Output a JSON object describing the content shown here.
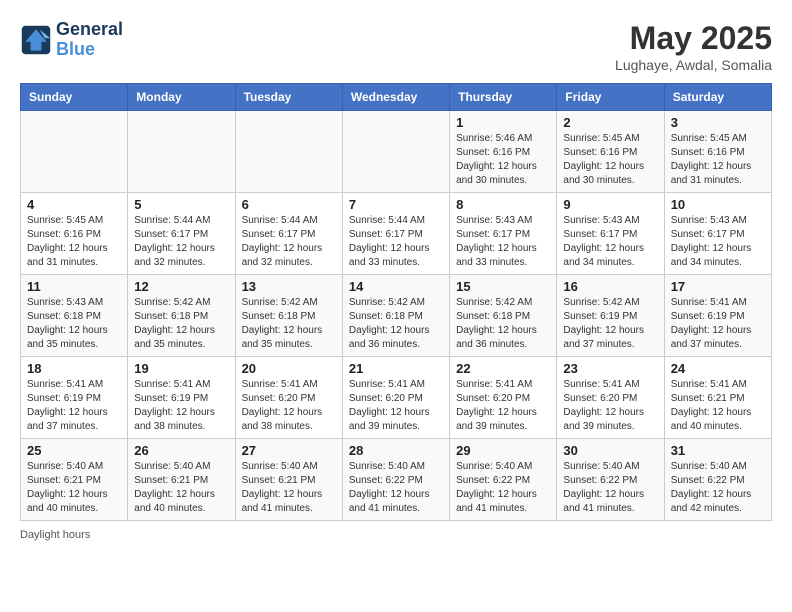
{
  "header": {
    "logo_line1": "General",
    "logo_line2": "Blue",
    "month_title": "May 2025",
    "location": "Lughaye, Awdal, Somalia"
  },
  "weekdays": [
    "Sunday",
    "Monday",
    "Tuesday",
    "Wednesday",
    "Thursday",
    "Friday",
    "Saturday"
  ],
  "weeks": [
    [
      {
        "day": "",
        "info": ""
      },
      {
        "day": "",
        "info": ""
      },
      {
        "day": "",
        "info": ""
      },
      {
        "day": "",
        "info": ""
      },
      {
        "day": "1",
        "info": "Sunrise: 5:46 AM\nSunset: 6:16 PM\nDaylight: 12 hours\nand 30 minutes."
      },
      {
        "day": "2",
        "info": "Sunrise: 5:45 AM\nSunset: 6:16 PM\nDaylight: 12 hours\nand 30 minutes."
      },
      {
        "day": "3",
        "info": "Sunrise: 5:45 AM\nSunset: 6:16 PM\nDaylight: 12 hours\nand 31 minutes."
      }
    ],
    [
      {
        "day": "4",
        "info": "Sunrise: 5:45 AM\nSunset: 6:16 PM\nDaylight: 12 hours\nand 31 minutes."
      },
      {
        "day": "5",
        "info": "Sunrise: 5:44 AM\nSunset: 6:17 PM\nDaylight: 12 hours\nand 32 minutes."
      },
      {
        "day": "6",
        "info": "Sunrise: 5:44 AM\nSunset: 6:17 PM\nDaylight: 12 hours\nand 32 minutes."
      },
      {
        "day": "7",
        "info": "Sunrise: 5:44 AM\nSunset: 6:17 PM\nDaylight: 12 hours\nand 33 minutes."
      },
      {
        "day": "8",
        "info": "Sunrise: 5:43 AM\nSunset: 6:17 PM\nDaylight: 12 hours\nand 33 minutes."
      },
      {
        "day": "9",
        "info": "Sunrise: 5:43 AM\nSunset: 6:17 PM\nDaylight: 12 hours\nand 34 minutes."
      },
      {
        "day": "10",
        "info": "Sunrise: 5:43 AM\nSunset: 6:17 PM\nDaylight: 12 hours\nand 34 minutes."
      }
    ],
    [
      {
        "day": "11",
        "info": "Sunrise: 5:43 AM\nSunset: 6:18 PM\nDaylight: 12 hours\nand 35 minutes."
      },
      {
        "day": "12",
        "info": "Sunrise: 5:42 AM\nSunset: 6:18 PM\nDaylight: 12 hours\nand 35 minutes."
      },
      {
        "day": "13",
        "info": "Sunrise: 5:42 AM\nSunset: 6:18 PM\nDaylight: 12 hours\nand 35 minutes."
      },
      {
        "day": "14",
        "info": "Sunrise: 5:42 AM\nSunset: 6:18 PM\nDaylight: 12 hours\nand 36 minutes."
      },
      {
        "day": "15",
        "info": "Sunrise: 5:42 AM\nSunset: 6:18 PM\nDaylight: 12 hours\nand 36 minutes."
      },
      {
        "day": "16",
        "info": "Sunrise: 5:42 AM\nSunset: 6:19 PM\nDaylight: 12 hours\nand 37 minutes."
      },
      {
        "day": "17",
        "info": "Sunrise: 5:41 AM\nSunset: 6:19 PM\nDaylight: 12 hours\nand 37 minutes."
      }
    ],
    [
      {
        "day": "18",
        "info": "Sunrise: 5:41 AM\nSunset: 6:19 PM\nDaylight: 12 hours\nand 37 minutes."
      },
      {
        "day": "19",
        "info": "Sunrise: 5:41 AM\nSunset: 6:19 PM\nDaylight: 12 hours\nand 38 minutes."
      },
      {
        "day": "20",
        "info": "Sunrise: 5:41 AM\nSunset: 6:20 PM\nDaylight: 12 hours\nand 38 minutes."
      },
      {
        "day": "21",
        "info": "Sunrise: 5:41 AM\nSunset: 6:20 PM\nDaylight: 12 hours\nand 39 minutes."
      },
      {
        "day": "22",
        "info": "Sunrise: 5:41 AM\nSunset: 6:20 PM\nDaylight: 12 hours\nand 39 minutes."
      },
      {
        "day": "23",
        "info": "Sunrise: 5:41 AM\nSunset: 6:20 PM\nDaylight: 12 hours\nand 39 minutes."
      },
      {
        "day": "24",
        "info": "Sunrise: 5:41 AM\nSunset: 6:21 PM\nDaylight: 12 hours\nand 40 minutes."
      }
    ],
    [
      {
        "day": "25",
        "info": "Sunrise: 5:40 AM\nSunset: 6:21 PM\nDaylight: 12 hours\nand 40 minutes."
      },
      {
        "day": "26",
        "info": "Sunrise: 5:40 AM\nSunset: 6:21 PM\nDaylight: 12 hours\nand 40 minutes."
      },
      {
        "day": "27",
        "info": "Sunrise: 5:40 AM\nSunset: 6:21 PM\nDaylight: 12 hours\nand 41 minutes."
      },
      {
        "day": "28",
        "info": "Sunrise: 5:40 AM\nSunset: 6:22 PM\nDaylight: 12 hours\nand 41 minutes."
      },
      {
        "day": "29",
        "info": "Sunrise: 5:40 AM\nSunset: 6:22 PM\nDaylight: 12 hours\nand 41 minutes."
      },
      {
        "day": "30",
        "info": "Sunrise: 5:40 AM\nSunset: 6:22 PM\nDaylight: 12 hours\nand 41 minutes."
      },
      {
        "day": "31",
        "info": "Sunrise: 5:40 AM\nSunset: 6:22 PM\nDaylight: 12 hours\nand 42 minutes."
      }
    ]
  ],
  "footer": "Daylight hours"
}
